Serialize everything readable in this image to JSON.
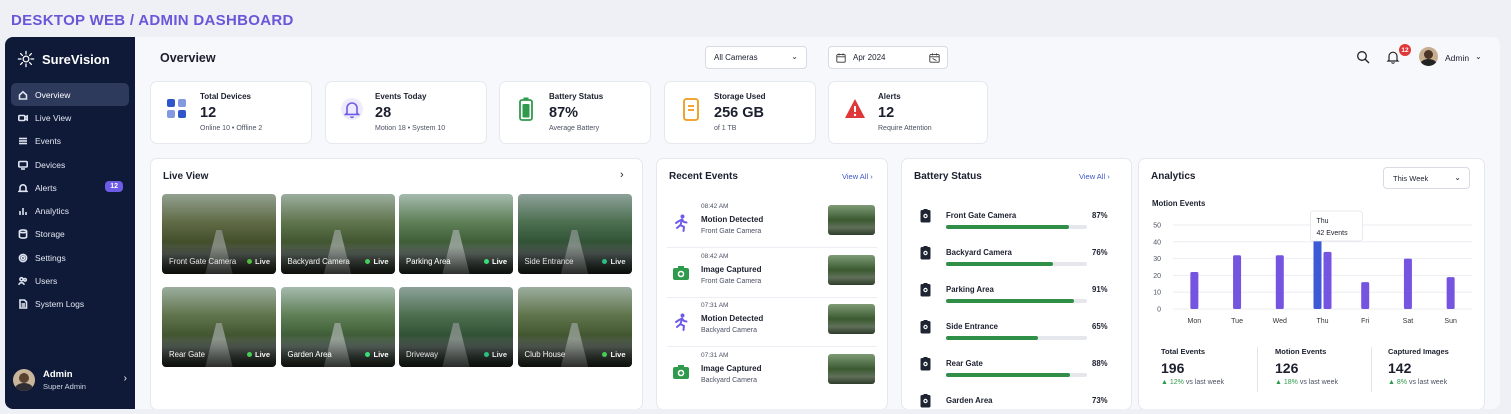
{
  "page_label": "DESKTOP WEB / ADMIN DASHBOARD",
  "sidebar": {
    "brand": "SureVision",
    "items": [
      {
        "label": "Overview",
        "icon": "home-icon",
        "active": true
      },
      {
        "label": "Live View",
        "icon": "video-icon"
      },
      {
        "label": "Events",
        "icon": "list-icon"
      },
      {
        "label": "Devices",
        "icon": "monitor-icon"
      },
      {
        "label": "Alerts",
        "icon": "bell-icon",
        "badge": "12"
      },
      {
        "label": "Analytics",
        "icon": "bar-chart-icon"
      },
      {
        "label": "Storage",
        "icon": "database-icon"
      },
      {
        "label": "Settings",
        "icon": "gear-icon"
      },
      {
        "label": "Users",
        "icon": "users-icon"
      },
      {
        "label": "System Logs",
        "icon": "file-icon"
      }
    ],
    "user": {
      "name": "Admin",
      "role": "Super Admin"
    }
  },
  "header": {
    "title": "Overview",
    "camera_select": "All Cameras",
    "date": "Apr 2024",
    "notification_count": "12",
    "user_label": "Admin"
  },
  "stats": [
    {
      "label": "Total Devices",
      "value": "12",
      "sub_a": "Online 10",
      "sub_b": "Offline 2",
      "icon": "grid-icon",
      "color": "#2f55c9"
    },
    {
      "label": "Events Today",
      "value": "28",
      "sub_a": "Motion 18",
      "sub_b": "System 10",
      "icon": "bell-icon",
      "color": "#6d5ce8"
    },
    {
      "label": "Battery Status",
      "value": "87%",
      "sub_a": "Average Battery",
      "icon": "battery-icon",
      "color": "#2f9a4c"
    },
    {
      "label": "Storage Used",
      "value": "256 GB",
      "sub_a": "of 1 TB",
      "icon": "storage-icon",
      "color": "#f09a1a"
    },
    {
      "label": "Alerts",
      "value": "12",
      "sub_a": "Require Attention",
      "icon": "alert-icon",
      "color": "#e03838"
    }
  ],
  "live_view": {
    "title": "Live View",
    "live_label": "Live",
    "cameras": [
      "Front Gate Camera",
      "Backyard Camera",
      "Parking Area",
      "Side Entrance",
      "Rear Gate",
      "Garden Area",
      "Driveway",
      "Club House"
    ]
  },
  "recent_events": {
    "title": "Recent Events",
    "view_all": "View All",
    "items": [
      {
        "time": "08:42 AM",
        "name": "Motion Detected",
        "location": "Front Gate Camera",
        "icon": "running-person-icon",
        "color": "#6d5ce8"
      },
      {
        "time": "08:42 AM",
        "name": "Image Captured",
        "location": "Front Gate Camera",
        "icon": "camera-icon",
        "color": "#2f9a4c"
      },
      {
        "time": "07:31 AM",
        "name": "Motion Detected",
        "location": "Backyard Camera",
        "icon": "running-person-icon",
        "color": "#6d5ce8"
      },
      {
        "time": "07:31 AM",
        "name": "Image Captured",
        "location": "Backyard Camera",
        "icon": "camera-icon",
        "color": "#2f9a4c"
      }
    ]
  },
  "battery_status": {
    "title": "Battery Status",
    "view_all": "View All",
    "items": [
      {
        "name": "Front Gate Camera",
        "percent": "87%",
        "value": 87,
        "icon": "camera-device-icon"
      },
      {
        "name": "Backyard Camera",
        "percent": "76%",
        "value": 76,
        "icon": "camera-device-icon"
      },
      {
        "name": "Parking Area",
        "percent": "91%",
        "value": 91,
        "icon": "camera-device-icon"
      },
      {
        "name": "Side Entrance",
        "percent": "65%",
        "value": 65,
        "icon": "camera-device-icon"
      },
      {
        "name": "Rear Gate",
        "percent": "88%",
        "value": 88,
        "icon": "camera-device-icon"
      },
      {
        "name": "Garden Area",
        "percent": "73%",
        "value": 73,
        "icon": "camera-device-icon"
      }
    ]
  },
  "analytics": {
    "title": "Analytics",
    "range": "This Week",
    "chart_title": "Motion Events",
    "tooltip_day": "Thu",
    "tooltip_value": "42 Events",
    "kpis": [
      {
        "label": "Total Events",
        "value": "196",
        "delta": "12%",
        "suffix": "vs last week"
      },
      {
        "label": "Motion Events",
        "value": "126",
        "delta": "18%",
        "suffix": "vs last week"
      },
      {
        "label": "Captured Images",
        "value": "142",
        "delta": "8%",
        "suffix": "vs last week"
      }
    ]
  },
  "chart_data": {
    "type": "bar",
    "title": "Motion Events",
    "categories": [
      "Mon",
      "Tue",
      "Wed",
      "Thu",
      "Fri",
      "Sat",
      "Sun"
    ],
    "series": [
      {
        "values": [
          22,
          32,
          32,
          42,
          16,
          30,
          19
        ]
      },
      {
        "values": [
          null,
          null,
          null,
          34,
          null,
          null,
          null
        ]
      }
    ],
    "ylim": [
      0,
      50
    ],
    "yticks": [
      0,
      10,
      20,
      30,
      40,
      50
    ],
    "grid": true,
    "highlight": "Thu"
  }
}
